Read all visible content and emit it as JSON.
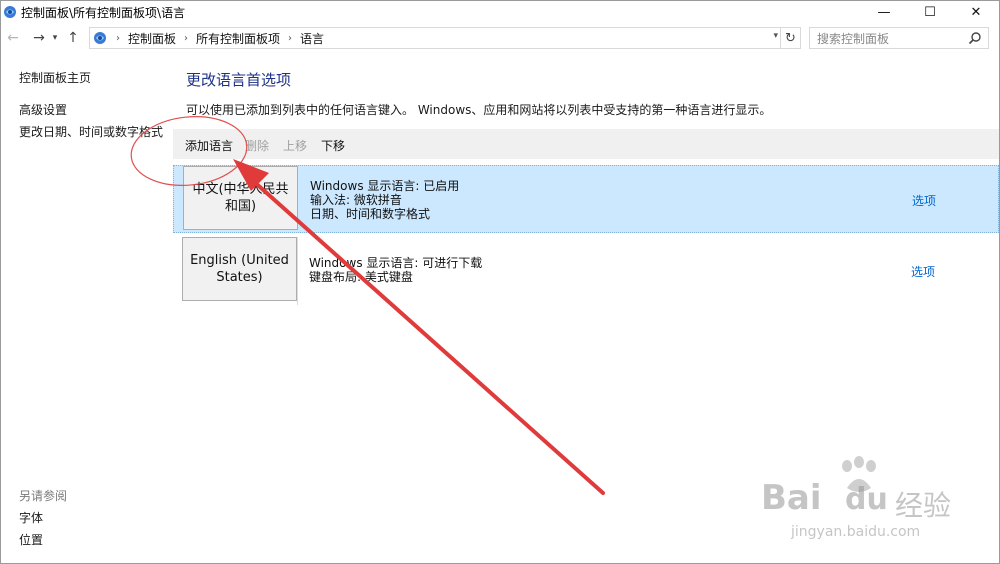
{
  "window": {
    "title": "控制面板\\所有控制面板项\\语言",
    "minimize": "—",
    "maximize": "☐",
    "close": "✕"
  },
  "address": {
    "crumbs": [
      "控制面板",
      "所有控制面板项",
      "语言"
    ],
    "search_placeholder": "搜索控制面板"
  },
  "left": {
    "links": [
      "控制面板主页",
      "高级设置",
      "更改日期、时间或数字格式"
    ],
    "see_also_heading": "另请参阅",
    "see_also": [
      "字体",
      "位置"
    ]
  },
  "main": {
    "title": "更改语言首选项",
    "description": "可以使用已添加到列表中的任何语言键入。 Windows、应用和网站将以列表中受支持的第一种语言进行显示。",
    "toolbar": {
      "add": "添加语言",
      "remove": "删除",
      "move_up": "上移",
      "move_down": "下移"
    },
    "languages": [
      {
        "name": "中文(中华人民共和国)",
        "lines": [
          "Windows 显示语言: 已启用",
          "输入法: 微软拼音",
          "日期、时间和数字格式"
        ],
        "options": "选项",
        "selected": true
      },
      {
        "name": "English (United States)",
        "lines": [
          "Windows 显示语言: 可进行下载",
          "键盘布局: 美式键盘"
        ],
        "options": "选项",
        "selected": false
      }
    ]
  },
  "watermark": {
    "brand": "Bai",
    "brand2": "du",
    "cn": "经验",
    "url": "jingyan.baidu.com"
  },
  "colors": {
    "title_blue": "#1e3287",
    "link_blue": "#0066cc",
    "selection": "#cce8ff",
    "annotation_red": "#e03a3a"
  }
}
